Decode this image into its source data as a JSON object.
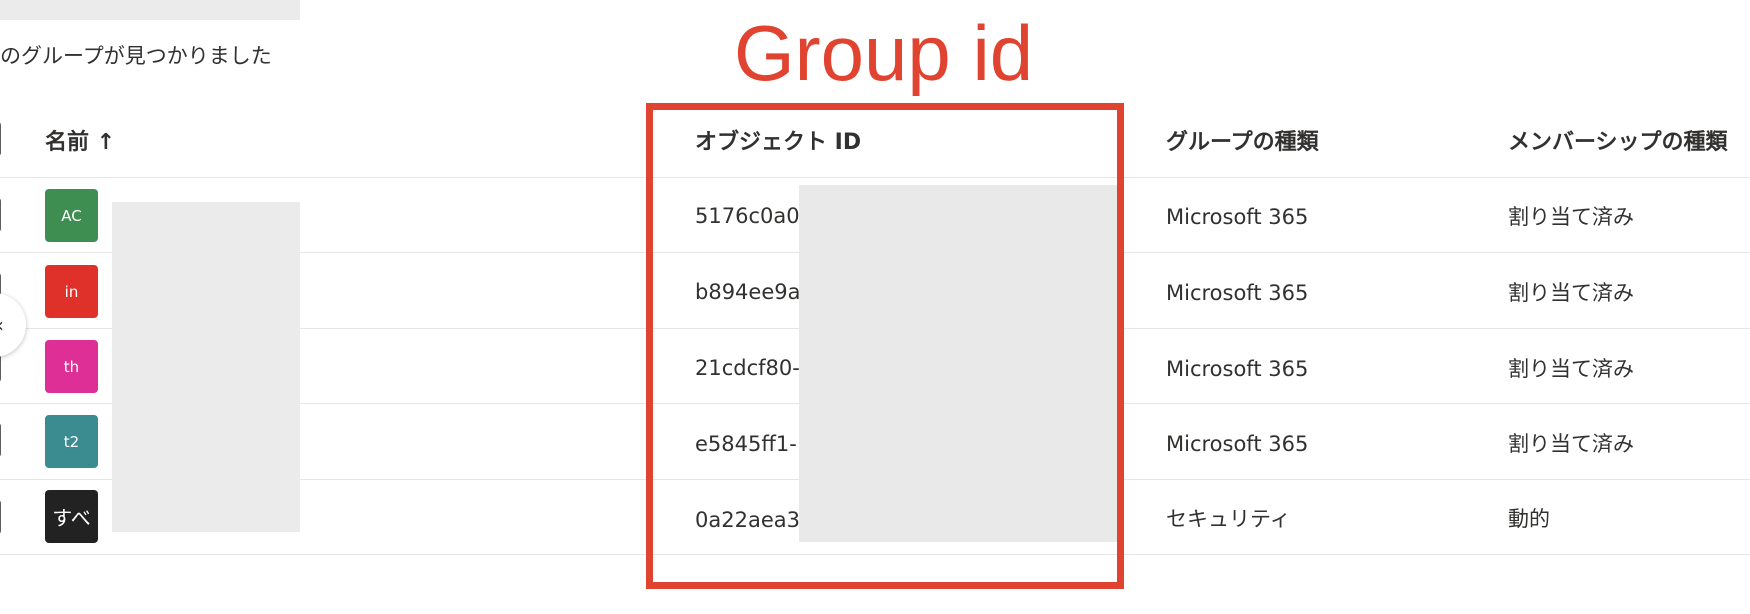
{
  "result_count_text": "のグループが見つかりました",
  "annotation": {
    "label": "Group id",
    "color": "#e0432f"
  },
  "table": {
    "headers": {
      "name": "名前 ↑",
      "object_id": "オブジェクト ID",
      "group_type": "グループの種類",
      "membership_type": "メンバーシップの種類"
    },
    "rows": [
      {
        "avatar": "AC",
        "avatar_color": "#3f8e51",
        "object_id": "5176c0a0-",
        "group_type": "Microsoft 365",
        "membership_type": "割り当て済み"
      },
      {
        "avatar": "in",
        "avatar_color": "#e0302a",
        "object_id": "b894ee9a-",
        "group_type": "Microsoft 365",
        "membership_type": "割り当て済み"
      },
      {
        "avatar": "th",
        "avatar_color": "#de2f96",
        "object_id": "21cdcf80-",
        "group_type": "Microsoft 365",
        "membership_type": "割り当て済み"
      },
      {
        "avatar": "t2",
        "avatar_color": "#3a8c91",
        "object_id": "e5845ff1-",
        "group_type": "Microsoft 365",
        "membership_type": "割り当て済み"
      },
      {
        "avatar": "すべ",
        "avatar_color": "#222222",
        "object_id": "0a22aea3-",
        "group_type": "セキュリティ",
        "membership_type": "動的"
      }
    ]
  },
  "icons": {
    "scroll_handle": "chevron-left-icon"
  }
}
